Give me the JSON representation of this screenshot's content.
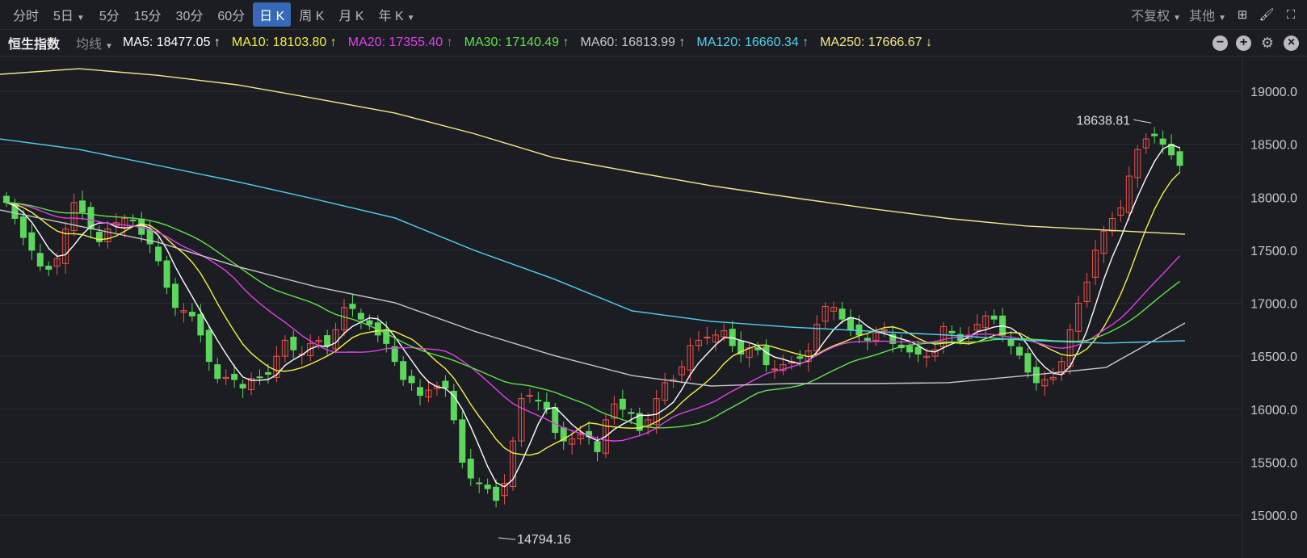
{
  "toolbar": {
    "periods": [
      "分时",
      "5日",
      "5分",
      "15分",
      "30分",
      "60分",
      "日 K",
      "周 K",
      "月 K",
      "年 K"
    ],
    "active_period": "日 K",
    "adjust": "不复权",
    "other": "其他"
  },
  "ma_bar": {
    "index_name": "恒生指数",
    "mode": "均线",
    "items": [
      {
        "label": "MA5: 18477.05 ↑",
        "color": "#ffffff"
      },
      {
        "label": "MA10: 18103.80 ↑",
        "color": "#f4f142"
      },
      {
        "label": "MA20: 17355.40 ↑",
        "color": "#e040e8"
      },
      {
        "label": "MA30: 17140.49 ↑",
        "color": "#5fe34a"
      },
      {
        "label": "MA60: 16813.99 ↑",
        "color": "#c8c8c8"
      },
      {
        "label": "MA120: 16660.34 ↑",
        "color": "#52d3f0"
      },
      {
        "label": "MA250: 17666.67 ↓",
        "color": "#f4ea8a"
      }
    ]
  },
  "chart_data": {
    "type": "candlestick",
    "title": "恒生指数 日K",
    "ylim": [
      14700,
      19250
    ],
    "yticks": [
      "19000.0",
      "18500.0",
      "18000.0",
      "17500.0",
      "17000.0",
      "16500.0",
      "16000.0",
      "15500.0",
      "15000.0"
    ],
    "up_color": "#f0504a",
    "down_color": "#5cd65c",
    "closes": [
      17950,
      17800,
      17620,
      17500,
      17350,
      17320,
      17420,
      17700,
      17950,
      17860,
      17700,
      17580,
      17700,
      17760,
      17800,
      17780,
      17650,
      17560,
      17400,
      17150,
      16960,
      16930,
      16880,
      16700,
      16450,
      16290,
      16300,
      16280,
      16200,
      16290,
      16300,
      16330,
      16500,
      16650,
      16560,
      16520,
      16620,
      16650,
      16600,
      16750,
      16960,
      16950,
      16850,
      16800,
      16700,
      16620,
      16450,
      16280,
      16250,
      16130,
      16180,
      16220,
      16200,
      15900,
      15500,
      15350,
      15300,
      15250,
      15140,
      15300,
      15700,
      16100,
      16130,
      16080,
      16000,
      15780,
      15700,
      15720,
      15760,
      15740,
      15600,
      15900,
      16050,
      16000,
      15960,
      15800,
      15900,
      16100,
      16250,
      16280,
      16400,
      16600,
      16650,
      16680,
      16700,
      16740,
      16600,
      16520,
      16580,
      16560,
      16420,
      16380,
      16420,
      16450,
      16480,
      16550,
      16800,
      16970,
      16960,
      16850,
      16750,
      16700,
      16650,
      16720,
      16750,
      16620,
      16580,
      16540,
      16520,
      16500,
      16560,
      16780,
      16720,
      16650,
      16700,
      16800,
      16880,
      16850,
      16700,
      16600,
      16510,
      16350,
      16250,
      16280,
      16300,
      16450,
      16750,
      17000,
      17200,
      17500,
      17680,
      17800,
      17900,
      18200,
      18450,
      18550,
      18580,
      18500,
      18400,
      18300
    ],
    "ma60": [
      17880,
      17728,
      17575,
      17347,
      17156,
      17004,
      16737,
      16509,
      16318,
      16219,
      16242,
      16242,
      16250,
      16318,
      16394,
      16813
    ],
    "ma120": [
      18550,
      18451,
      18300,
      18147,
      17980,
      17804,
      17500,
      17232,
      16928,
      16829,
      16775,
      16737,
      16699,
      16650,
      16623,
      16646
    ],
    "ma250": [
      19160,
      19213,
      19150,
      19061,
      18930,
      18794,
      18600,
      18375,
      18240,
      18109,
      18000,
      17895,
      17800,
      17728,
      17690,
      17651
    ],
    "annotations": {
      "high": "18638.81",
      "low": "14794.16"
    }
  }
}
